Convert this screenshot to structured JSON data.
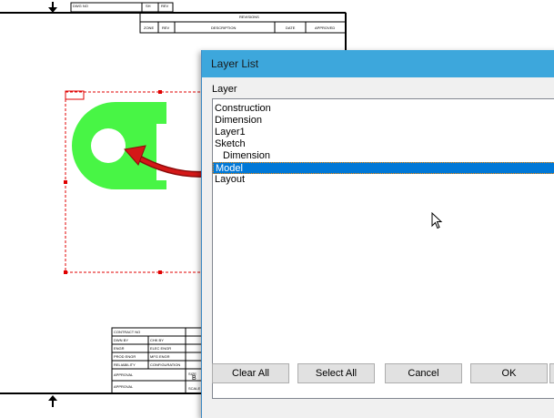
{
  "drawing": {
    "title_block_top": {
      "dwg_no": "DWG NO",
      "sh": "SH",
      "rev": "REV",
      "revisions": "REVISIONS",
      "col_zone": "ZONE",
      "col_rev": "REV",
      "col_description": "DESCRIPTION",
      "col_date": "DATE",
      "col_approved": "APPROVED"
    },
    "title_block_bottom": {
      "contract_no": "CONTRACT NO",
      "dwn_by": "DWN BY",
      "chk_by": "CHK BY",
      "engr": "ENGR",
      "elec_engr": "ELEC ENGR",
      "prod_engr": "PROD ENGR",
      "mfg_engr": "MFG ENGR",
      "reliability": "RELIABILITY",
      "configuration": "CONFIGURATION",
      "approval": "APPROVAL",
      "approval_2": "APPROVAL",
      "size": "SIZE",
      "size_value": "B",
      "scale": "SCALE"
    },
    "colors": {
      "shape_fill": "#48f545",
      "selection_box": "#e00000",
      "arrow": "#d41818"
    }
  },
  "dialog": {
    "title": "Layer List",
    "layer_label": "Layer",
    "layers": [
      {
        "name": "Construction",
        "indent": false,
        "selected": false
      },
      {
        "name": "Dimension",
        "indent": false,
        "selected": false
      },
      {
        "name": "Layer1",
        "indent": false,
        "selected": false
      },
      {
        "name": "Sketch",
        "indent": false,
        "selected": false
      },
      {
        "name": "Dimension",
        "indent": true,
        "selected": false
      },
      {
        "name": "Model",
        "indent": false,
        "selected": true
      },
      {
        "name": "Layout",
        "indent": false,
        "selected": false
      }
    ],
    "buttons": {
      "clear_all": "Clear All",
      "select_all": "Select All",
      "cancel": "Cancel",
      "ok": "OK"
    },
    "colors": {
      "titlebar": "#3da7dc",
      "selection": "#0078d7"
    }
  }
}
